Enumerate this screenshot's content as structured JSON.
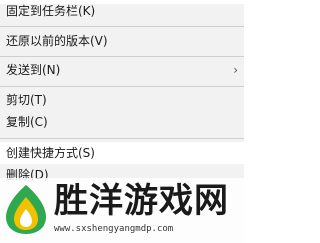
{
  "context_menu": {
    "items": [
      {
        "label": "固定到任务栏(K)"
      },
      {
        "label": "还原以前的版本(V)"
      },
      {
        "label": "发送到(N)",
        "submenu_icon": "chevron-right-icon"
      },
      {
        "label": "剪切(T)"
      },
      {
        "label": "复制(C)"
      },
      {
        "label": "创建快捷方式(S)"
      },
      {
        "label": "删除(D)"
      }
    ]
  },
  "watermark": {
    "title": "胜洋游戏网",
    "url": "www.sxshengyangmdp.com",
    "logo_icon": "flame-drop-logo"
  },
  "colors": {
    "menu_background": "#f2f2f2",
    "highlight_background": "#ffffff",
    "separator": "#cfcfcf",
    "text": "#1a1a1a",
    "logo_green": "#2fa84f",
    "logo_yellow": "#f2c200"
  }
}
